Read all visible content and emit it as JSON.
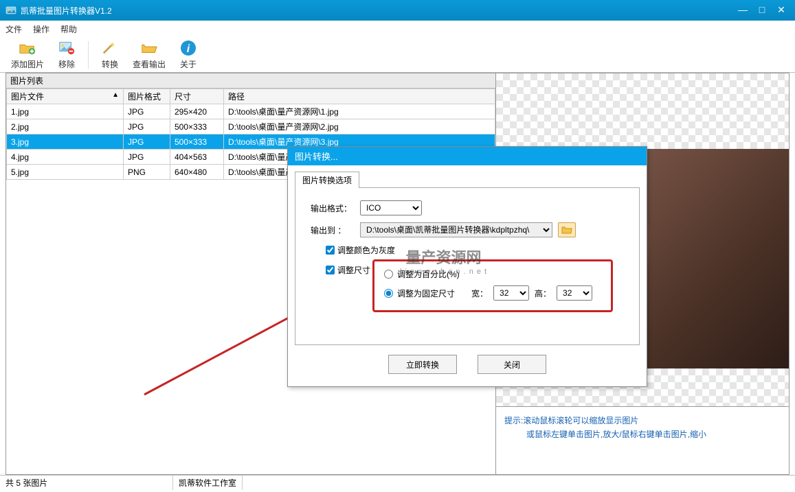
{
  "app": {
    "title": "凯蒂批量图片转换器V1.2"
  },
  "menu": {
    "file": "文件",
    "action": "操作",
    "help": "帮助"
  },
  "toolbar": {
    "add": "添加图片",
    "remove": "移除",
    "convert": "转换",
    "view_output": "查看输出",
    "about": "关于"
  },
  "list": {
    "title": "图片列表",
    "cols": {
      "file": "图片文件",
      "format": "图片格式",
      "size": "尺寸",
      "path": "路径"
    },
    "rows": [
      {
        "file": "1.jpg",
        "format": "JPG",
        "size": "295×420",
        "path": "D:\\tools\\桌面\\量产资源网\\1.jpg",
        "selected": false
      },
      {
        "file": "2.jpg",
        "format": "JPG",
        "size": "500×333",
        "path": "D:\\tools\\桌面\\量产资源网\\2.jpg",
        "selected": false
      },
      {
        "file": "3.jpg",
        "format": "JPG",
        "size": "500×333",
        "path": "D:\\tools\\桌面\\量产资源网\\3.jpg",
        "selected": true
      },
      {
        "file": "4.jpg",
        "format": "JPG",
        "size": "404×563",
        "path": "D:\\tools\\桌面\\量产资源网\\4.jpg",
        "selected": false
      },
      {
        "file": "5.jpg",
        "format": "PNG",
        "size": "640×480",
        "path": "D:\\tools\\桌面\\量产资源网\\5.jpg",
        "selected": false
      }
    ]
  },
  "tips": {
    "line1": "提示:滚动鼠标滚轮可以缩放显示图片",
    "line2": "或鼠标左键单击图片,放大/鼠标右键单击图片,缩小"
  },
  "status": {
    "count_text": "共 5 张图片",
    "studio": "凯蒂软件工作室"
  },
  "dialog": {
    "title": "图片转换...",
    "tab": "图片转换选项",
    "output_format_label": "输出格式：",
    "output_format": "ICO",
    "output_to_label": "输出到 ：",
    "output_path": "D:\\tools\\桌面\\凯蒂批量图片转换器\\kdpltpzhq\\",
    "grayscale": "调整颜色为灰度",
    "resize": "调整尺寸",
    "resize_percent": "调整为百分比(%)",
    "resize_fixed": "调整为固定尺寸",
    "width_label": "宽：",
    "width_value": "32",
    "height_label": "高：",
    "height_value": "32",
    "btn_convert": "立即转换",
    "btn_close": "关闭"
  },
  "watermark": {
    "main": "量产资源网",
    "sub": "l i a n g c h a n . n e t"
  }
}
